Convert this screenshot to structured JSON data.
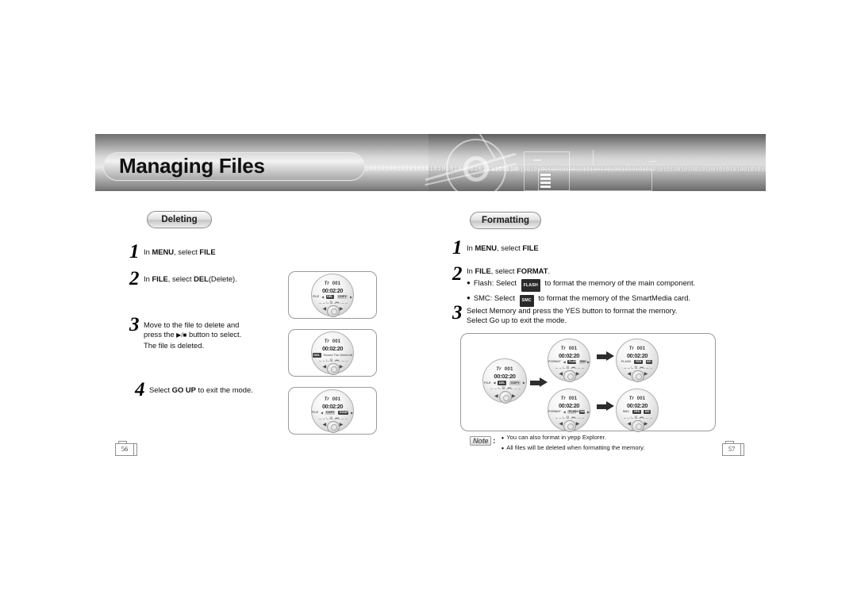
{
  "header": {
    "title": "Managing Files",
    "bits": "1001010010111010101001010101001110110011001101010011011101010010010010100101010101010101010010101100110",
    "bits_right": "100101001001010010010100101010010010010101010101010100101001010010101010010101001010101010"
  },
  "left_section": {
    "pill_label": "Deleting",
    "steps": [
      {
        "num": "1",
        "text_before": "In ",
        "bold1": "MENU",
        "mid": ", select ",
        "bold2": "FILE",
        "text_after": ""
      },
      {
        "num": "2",
        "text_before": "In ",
        "bold1": "FILE",
        "mid": ", select ",
        "bold2": "DEL",
        "text_after": "(Delete)."
      },
      {
        "num": "3",
        "line1": "Move to the file to delete and",
        "line2_a": "press the ",
        "line2_glyph": "▶/■",
        "line2_b": " button to select.",
        "line3": "The file is deleted."
      },
      {
        "num": "4",
        "text_before": "Select ",
        "bold1": "GO UP",
        "mid": " to exit the mode.",
        "bold2": "",
        "text_after": ""
      }
    ],
    "devices": [
      {
        "name": "file-menu-del",
        "track_label": "Tr",
        "track_num": "001",
        "time": "00:02:20",
        "mode_label": "FILE",
        "chip1": "DEL",
        "chip2": "COPY",
        "chip1_active": true,
        "chip2_active": false,
        "icons": "♪   ▤  ▬"
      },
      {
        "name": "file-selected-track",
        "track_label": "Tr",
        "track_num": "001",
        "time": "00:02:20",
        "mode_label": "",
        "chip1": "DEL",
        "title_text": "Round The World-08",
        "chip1_active": true,
        "icons": "♪   ▤  ▬"
      },
      {
        "name": "file-menu-goup",
        "track_label": "Tr",
        "track_num": "001",
        "time": "00:02:20",
        "mode_label": "FILE",
        "chip1": "COPY",
        "chip2": "GOUP",
        "chip1_active": false,
        "chip2_active": true,
        "icons": "♪   ▤  ▬"
      }
    ]
  },
  "right_section": {
    "pill_label": "Formatting",
    "steps": [
      {
        "num": "1",
        "text_before": "In ",
        "bold1": "MENU",
        "mid": ", select ",
        "bold2": "FILE",
        "text_after": ""
      },
      {
        "num": "2",
        "head_before": "In ",
        "head_bold1": "FILE",
        "head_mid": ", select ",
        "head_bold2": "FORMAT",
        "head_after": ".",
        "bullets": [
          {
            "before": "Flash: Select ",
            "badge": "FLASH",
            "after": " to format the memory of the main component."
          },
          {
            "before": "SMC: Select ",
            "badge": "SMC",
            "after": " to format the memory of the SmartMedia card."
          }
        ]
      },
      {
        "num": "3",
        "line1": "Select Memory and press the YES button to format the memory.",
        "line2": "Select Go up to exit the mode."
      }
    ],
    "flow": {
      "devices": [
        {
          "name": "format-entry",
          "track_label": "Tr",
          "track_num": "001",
          "time": "00:02:20",
          "mode_label": "FILE",
          "chip1": "DEL",
          "chip2": "COPY",
          "chip1_active": true,
          "chip2_active": false,
          "icons": "♪   ▤  ▬"
        },
        {
          "name": "format-select-flash",
          "track_label": "Tr",
          "track_num": "001",
          "time": "00:02:20",
          "mode_label": "FORMAT",
          "chip1": "FLASH",
          "chip2": "SMC",
          "chip1_active": true,
          "chip2_active": false,
          "icons": "♪   ▤  ▬"
        },
        {
          "name": "format-flash-confirm",
          "track_label": "Tr",
          "track_num": "001",
          "time": "00:02:20",
          "mode_label": "FLASH",
          "chip1": "YES",
          "chip2": "NO",
          "chip1_active": true,
          "chip2_active": true,
          "icons": "♪   ▤  ▬"
        },
        {
          "name": "format-select-smc",
          "track_label": "Tr",
          "track_num": "001",
          "time": "00:02:20",
          "mode_label": "FORMAT",
          "chip1": "FLASH",
          "chip2": "SMC",
          "chip1_active": false,
          "chip2_active": true,
          "icons": "♪   ▤  ▬"
        },
        {
          "name": "format-smc-confirm",
          "track_label": "Tr",
          "track_num": "001",
          "time": "00:02:20",
          "mode_label": "SMC",
          "chip1": "YES",
          "chip2": "NO",
          "chip1_active": true,
          "chip2_active": true,
          "icons": "♪   ▤  ▬"
        }
      ]
    },
    "note": {
      "tag": "Note",
      "colon": ":",
      "items": [
        "You can also format in yepp Explorer.",
        "All files will be deleted when formatting the memory."
      ]
    }
  },
  "pagination": {
    "left": "56",
    "right": "57"
  },
  "colors": {
    "ink": "#111111",
    "frame": "#9a9a9a",
    "chip": "#3c3c3c",
    "banner_dark": "#6e6e6e"
  }
}
